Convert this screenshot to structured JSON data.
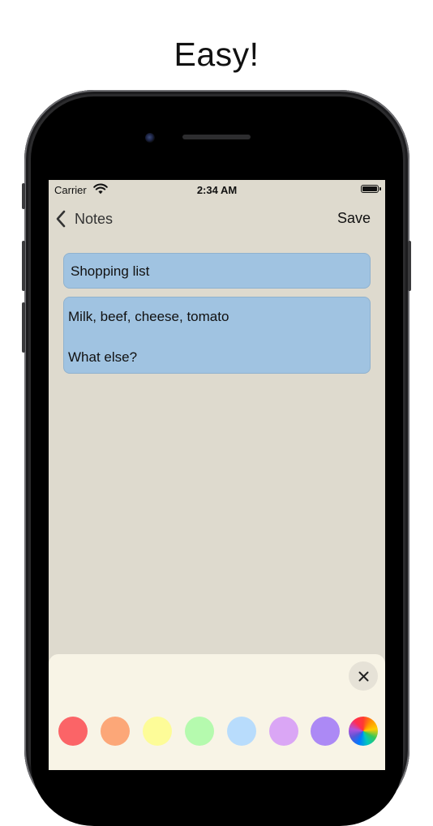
{
  "headline": "Easy!",
  "status_bar": {
    "carrier": "Carrier",
    "time": "2:34 AM",
    "wifi_icon": "wifi-icon",
    "battery_icon": "battery-icon"
  },
  "nav": {
    "back_icon": "chevron-left-icon",
    "back_label": "Notes",
    "save_label": "Save"
  },
  "note": {
    "title": "Shopping list",
    "body_lines": [
      "Milk, beef, cheese, tomato",
      "",
      "What else?"
    ]
  },
  "colors": {
    "screen_background": "#dedace",
    "field_background": "#a0c3e1",
    "sheet_background": "#f8f4e6"
  },
  "color_picker": {
    "close_icon": "close-icon",
    "swatches": [
      {
        "name": "red",
        "color": "#fb6467"
      },
      {
        "name": "orange",
        "color": "#fca778"
      },
      {
        "name": "yellow",
        "color": "#fdfc98"
      },
      {
        "name": "green",
        "color": "#b5faae"
      },
      {
        "name": "blue",
        "color": "#b8dcfc"
      },
      {
        "name": "lilac",
        "color": "#daa6f5"
      },
      {
        "name": "purple",
        "color": "#ac89f5"
      },
      {
        "name": "custom",
        "color": "conic-gradient"
      }
    ]
  }
}
